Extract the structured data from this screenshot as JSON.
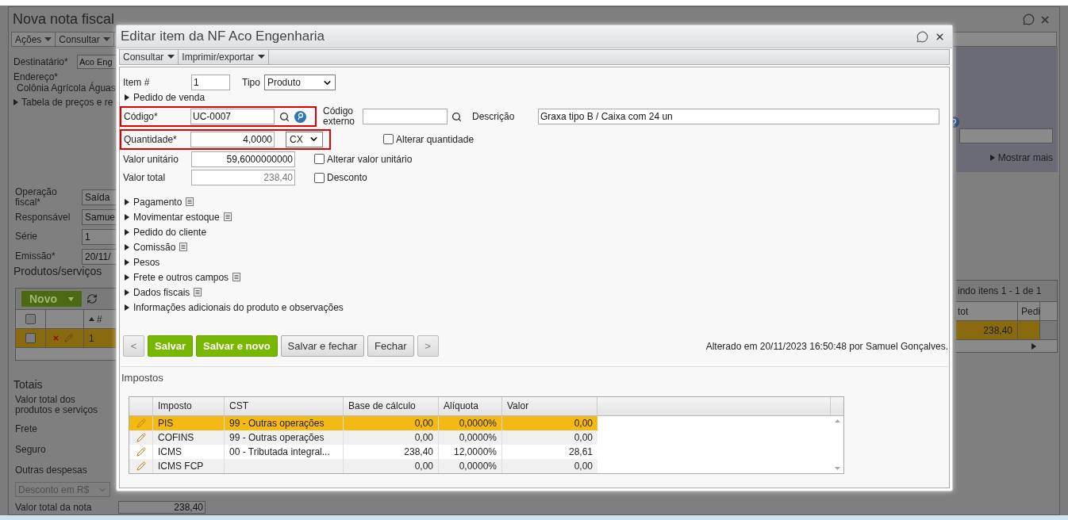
{
  "background_window": {
    "title": "Nova nota fiscal",
    "menu": [
      "Ações",
      "Consultar"
    ],
    "destinatario": {
      "label": "Destinatário*",
      "value": "Aco Eng"
    },
    "endereco": {
      "label": "Endereço*",
      "value": "Colônia Agrícola Águas"
    },
    "price_table": {
      "label": "Tabela de preços e re",
      "expanded": false
    },
    "fiscal_fields": [
      {
        "label": "Operação fiscal*",
        "value": "Saída"
      },
      {
        "label": "Responsável",
        "value": "Samue"
      },
      {
        "label": "Série",
        "value": "1"
      },
      {
        "label": "Emissão*",
        "value": "20/11/"
      }
    ],
    "show_more": "Mostrar mais",
    "products": {
      "title": "Produtos/serviços",
      "new_button": "Novo",
      "pager": "indo itens 1 - 1 de 1",
      "all_checked": false,
      "columns": [
        "#",
        "tot",
        "Pedi"
      ],
      "rows": [
        {
          "number": "1",
          "total": "238,40",
          "selected": true,
          "checked": false
        }
      ]
    },
    "totals": {
      "title": "Totais",
      "labels": [
        "Valor total dos produtos e serviços",
        "Frete",
        "Seguro",
        "Outras despesas"
      ],
      "discount_select": "Desconto em R$",
      "total": {
        "label": "Valor total da nota",
        "value": "238,40"
      }
    }
  },
  "dialog": {
    "title": "Editar item da NF Aco Engenharia",
    "menu": [
      "Consultar",
      "Imprimir/exportar"
    ],
    "item": {
      "label": "Item #",
      "value": "1"
    },
    "tipo": {
      "label": "Tipo",
      "value": "Produto"
    },
    "sales_order": {
      "label": "Pedido de venda",
      "expanded": false
    },
    "codigo": {
      "label": "Código*",
      "value": "UC-0007",
      "highlighted": true
    },
    "codigo_externo": {
      "label": "Código externo"
    },
    "descricao": {
      "label": "Descrição",
      "value": "Graxa tipo B / Caixa com 24 un"
    },
    "quantidade": {
      "label": "Quantidade*",
      "value": "4,0000",
      "unit": "CX",
      "highlighted": true
    },
    "valor_unitario": {
      "label": "Valor unitário",
      "value": "59,6000000000",
      "disabled": false
    },
    "valor_total": {
      "label": "Valor total",
      "value": "238,40",
      "disabled": true
    },
    "checkboxes": [
      {
        "label": "Alterar quantidade",
        "checked": false
      },
      {
        "label": "Alterar valor unitário",
        "checked": false
      },
      {
        "label": "Desconto",
        "checked": false
      }
    ],
    "sections": [
      {
        "label": "Pagamento",
        "has_note": true,
        "expanded": false
      },
      {
        "label": "Movimentar estoque",
        "has_note": true,
        "expanded": false
      },
      {
        "label": "Pedido do cliente",
        "has_note": false,
        "expanded": false
      },
      {
        "label": "Comissão",
        "has_note": true,
        "expanded": false
      },
      {
        "label": "Pesos",
        "has_note": false,
        "expanded": false
      },
      {
        "label": "Frete e outros campos",
        "has_note": true,
        "expanded": false
      },
      {
        "label": "Dados fiscais",
        "has_note": true,
        "expanded": false
      },
      {
        "label": "Informações adicionais do produto e observações",
        "has_note": false,
        "expanded": false
      }
    ],
    "buttons": [
      {
        "label": "<",
        "kind": "nav",
        "disabled": true
      },
      {
        "label": "Salvar",
        "kind": "primary",
        "disabled": false
      },
      {
        "label": "Salvar e novo",
        "kind": "primary",
        "disabled": false
      },
      {
        "label": "Salvar e fechar",
        "kind": "secondary",
        "disabled": false
      },
      {
        "label": "Fechar",
        "kind": "secondary",
        "disabled": false
      },
      {
        "label": ">",
        "kind": "nav",
        "disabled": true
      }
    ],
    "audit": "Alterado em 20/11/2023 16:50:48 por Samuel Gonçalves.",
    "taxes": {
      "title": "Impostos",
      "columns": [
        "Imposto",
        "CST",
        "Base de cálculo",
        "Alíquota",
        "Valor"
      ],
      "rows": [
        {
          "imposto": "PIS",
          "cst": "99 - Outras operações",
          "base": "0,00",
          "aliquota": "0,0000%",
          "valor": "0,00",
          "selected": true
        },
        {
          "imposto": "COFINS",
          "cst": "99 - Outras operações",
          "base": "0,00",
          "aliquota": "0,0000%",
          "valor": "0,00",
          "selected": false
        },
        {
          "imposto": "ICMS",
          "cst": "00 - Tributada integral...",
          "base": "238,40",
          "aliquota": "12,0000%",
          "valor": "28,61",
          "selected": false
        },
        {
          "imposto": "ICMS FCP",
          "base": "0,00",
          "aliquota": "0,0000%",
          "valor": "0,00",
          "selected": false
        }
      ]
    }
  }
}
